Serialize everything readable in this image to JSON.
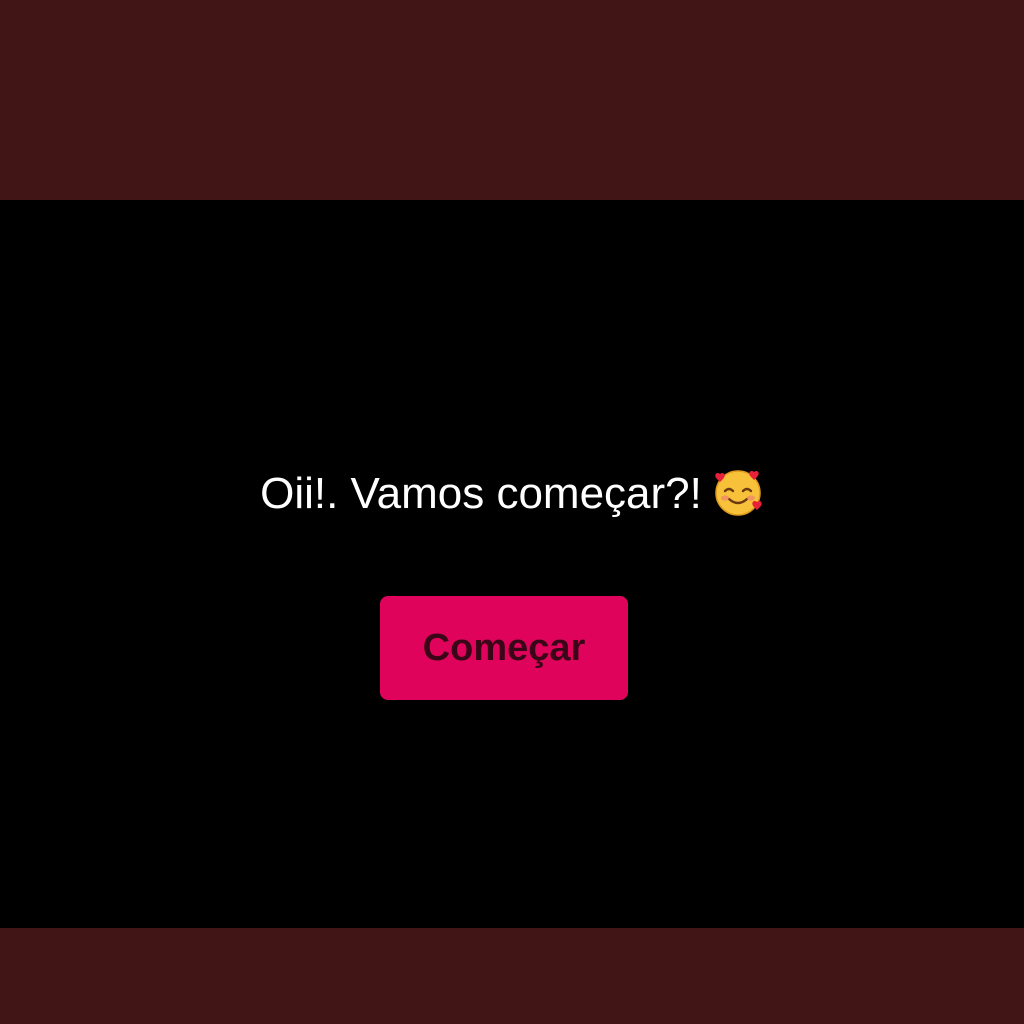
{
  "greeting": {
    "text": "Oii!. Vamos começar?!",
    "emoji_icon": "smiling-face-with-hearts-icon"
  },
  "start_button": {
    "label": "Começar"
  },
  "colors": {
    "band": "#411416",
    "stage": "#000000",
    "text": "#ffffff",
    "button_bg": "#e0035b",
    "button_text": "#3a0617"
  }
}
